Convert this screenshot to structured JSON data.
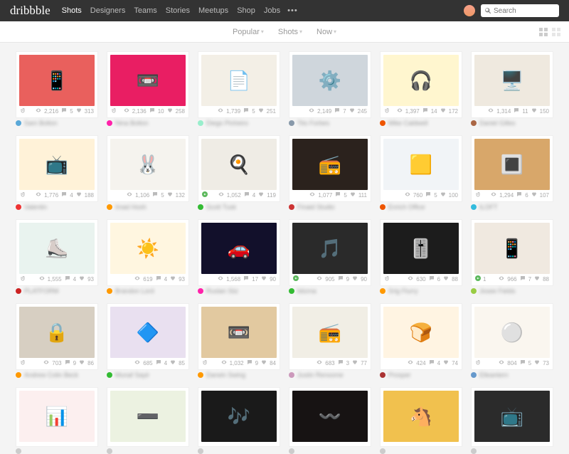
{
  "brand": "dribbble",
  "nav": {
    "items": [
      "Shots",
      "Designers",
      "Teams",
      "Stories",
      "Meetups",
      "Shop",
      "Jobs"
    ],
    "active": 0
  },
  "search": {
    "placeholder": "Search"
  },
  "filters": [
    {
      "label": "Popular"
    },
    {
      "label": "Shots"
    },
    {
      "label": "Now"
    }
  ],
  "cards": [
    {
      "bg": "#e9605d",
      "art": "📱",
      "views": "2,216",
      "comments": "5",
      "likes": "313",
      "dot": "#5aa8d8",
      "author": "Sam Bolton",
      "attach": true
    },
    {
      "bg": "#e91e63",
      "art": "📼",
      "views": "2,136",
      "comments": "10",
      "likes": "258",
      "dot": "#f2a",
      "author": "Nina Bolton",
      "attach": true
    },
    {
      "bg": "#f3efe6",
      "art": "📄",
      "views": "1,739",
      "comments": "5",
      "likes": "251",
      "dot": "#9ec",
      "author": "Diego Pinheiro",
      "attach": false
    },
    {
      "bg": "#cfd6dc",
      "art": "⚙️",
      "views": "2,149",
      "comments": "7",
      "likes": "245",
      "dot": "#89a",
      "author": "Tito Forbes",
      "attach": false
    },
    {
      "bg": "#fff6cf",
      "art": "🎧",
      "views": "1,397",
      "comments": "14",
      "likes": "172",
      "dot": "#e50",
      "author": "Mike Caldwell",
      "attach": true
    },
    {
      "bg": "#efe9df",
      "art": "🖥️",
      "views": "1,314",
      "comments": "11",
      "likes": "150",
      "dot": "#a64",
      "author": "Daniel Gilles",
      "attach": false
    },
    {
      "bg": "#fff2d8",
      "art": "📺",
      "views": "1,776",
      "comments": "4",
      "likes": "188",
      "dot": "#e33",
      "author": "Valentin",
      "attach": true
    },
    {
      "bg": "#f5f3ee",
      "art": "🐰",
      "views": "1,106",
      "comments": "5",
      "likes": "132",
      "dot": "#f90",
      "author": "Imad Hosh",
      "attach": false
    },
    {
      "bg": "#efece5",
      "art": "🍳",
      "views": "1,052",
      "comments": "4",
      "likes": "119",
      "dot": "#3b3",
      "author": "Scott Tusk",
      "attach": false,
      "rebound": true
    },
    {
      "bg": "#2b221d",
      "art": "📻",
      "views": "1,077",
      "comments": "5",
      "likes": "111",
      "dot": "#c33",
      "author": "Finaid Studio",
      "attach": false
    },
    {
      "bg": "#f1f4f7",
      "art": "🟨",
      "views": "760",
      "comments": "5",
      "likes": "100",
      "dot": "#e50",
      "author": "Enrich Office",
      "attach": false
    },
    {
      "bg": "#d8a76a",
      "art": "🔳",
      "views": "1,294",
      "comments": "6",
      "likes": "107",
      "dot": "#3bd",
      "author": "ILOFT",
      "attach": true
    },
    {
      "bg": "#e9f3ef",
      "art": "⛸️",
      "views": "1,555",
      "comments": "4",
      "likes": "93",
      "dot": "#c22",
      "author": "PLATFORM",
      "attach": true
    },
    {
      "bg": "#fff6e0",
      "art": "☀️",
      "views": "619",
      "comments": "4",
      "likes": "93",
      "dot": "#f90",
      "author": "Brandon Lord",
      "attach": false
    },
    {
      "bg": "#12102b",
      "art": "🚗",
      "views": "1,568",
      "comments": "17",
      "likes": "90",
      "dot": "#f2a",
      "author": "Ruslan Siiz",
      "attach": false
    },
    {
      "bg": "#2a2a2a",
      "art": "🎵",
      "views": "905",
      "comments": "9",
      "likes": "90",
      "dot": "#3b3",
      "author": "bitzma",
      "attach": false,
      "rebound": true
    },
    {
      "bg": "#1c1c1c",
      "art": "🎚️",
      "views": "630",
      "comments": "6",
      "likes": "88",
      "dot": "#f90",
      "author": "Srig Flurry",
      "attach": true
    },
    {
      "bg": "#f0e9e0",
      "art": "📱",
      "views": "966",
      "comments": "7",
      "likes": "88",
      "dot": "#9c4",
      "author": "Josee Fields",
      "attach": false,
      "rebound": true,
      "reboundCount": "1"
    },
    {
      "bg": "#d7cfc2",
      "art": "🔒",
      "views": "703",
      "comments": "9",
      "likes": "86",
      "dot": "#f90",
      "author": "Andrew Colin Beck",
      "attach": true
    },
    {
      "bg": "#e9e0f0",
      "art": "🔷",
      "views": "685",
      "comments": "4",
      "likes": "85",
      "dot": "#3b3",
      "author": "Munaf Sayir",
      "attach": false
    },
    {
      "bg": "#e2c9a0",
      "art": "📼",
      "views": "1,032",
      "comments": "9",
      "likes": "84",
      "dot": "#f90",
      "author": "Darwin Swing",
      "attach": true
    },
    {
      "bg": "#f1eee5",
      "art": "📻",
      "views": "683",
      "comments": "3",
      "likes": "77",
      "dot": "#c9b",
      "author": "Justin Rensome",
      "attach": false
    },
    {
      "bg": "#fff4e2",
      "art": "🍞",
      "views": "424",
      "comments": "4",
      "likes": "74",
      "dot": "#a33",
      "author": "Prosper",
      "attach": false
    },
    {
      "bg": "#faf6ef",
      "art": "⚪",
      "views": "804",
      "comments": "5",
      "likes": "73",
      "dot": "#69c",
      "author": "Elleantern",
      "attach": true
    },
    {
      "bg": "#fcefef",
      "art": "📊",
      "views": "",
      "comments": "",
      "likes": "",
      "dot": "#ccc",
      "author": "",
      "attach": false
    },
    {
      "bg": "#ecf2e1",
      "art": "➖",
      "views": "",
      "comments": "",
      "likes": "",
      "dot": "#ccc",
      "author": "",
      "attach": false
    },
    {
      "bg": "#1a1a1a",
      "art": "🎶",
      "views": "",
      "comments": "",
      "likes": "",
      "dot": "#ccc",
      "author": "",
      "attach": false
    },
    {
      "bg": "#171313",
      "art": "〰️",
      "views": "",
      "comments": "",
      "likes": "",
      "dot": "#ccc",
      "author": "",
      "attach": false
    },
    {
      "bg": "#f1c14e",
      "art": "🐴",
      "views": "",
      "comments": "",
      "likes": "",
      "dot": "#ccc",
      "author": "",
      "attach": false
    },
    {
      "bg": "#2b2b2b",
      "art": "📺",
      "views": "",
      "comments": "",
      "likes": "",
      "dot": "#ccc",
      "author": "",
      "attach": false
    }
  ]
}
